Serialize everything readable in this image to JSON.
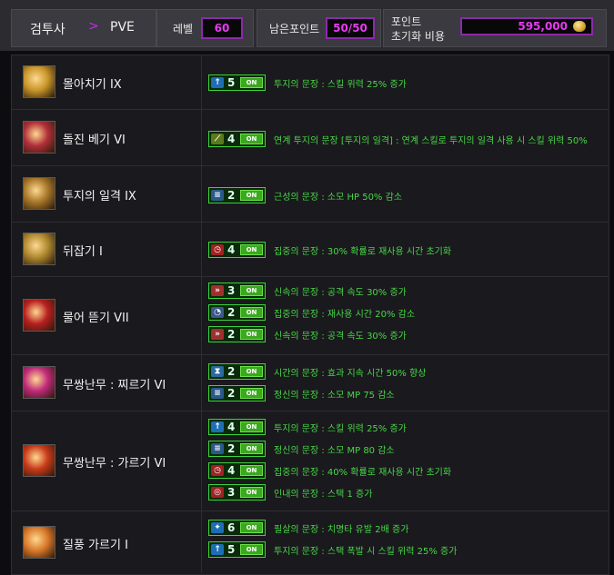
{
  "header": {
    "class_name": "검투사",
    "arrow": ">",
    "mode": "PVE",
    "level_label": "레벨",
    "level_value": "60",
    "points_label": "남은포인트",
    "points_value": "50/50",
    "reset_label_1": "포인트",
    "reset_label_2": "초기화 비용",
    "reset_value": "595,000",
    "coin_icon": "gold-coin-icon"
  },
  "skills": [
    {
      "name": "몰아치기 IX",
      "icon": "storm-slash-icon",
      "icon_color": "#c8962a",
      "sigils": [
        {
          "icon": "attack-up-icon",
          "level": "5",
          "on": "ON",
          "text": "투지의 문장 : 스킬 위력 25% 증가"
        }
      ]
    },
    {
      "name": "돌진 베기 VI",
      "icon": "dash-slash-icon",
      "icon_color": "#b0303a",
      "sigils": [
        {
          "icon": "sword-icon",
          "level": "4",
          "on": "ON",
          "text": "연계 투지의 문장 [투지의 일격] : 연계 스킬로 투지의 일격 사용 시 스킬 위력 50%"
        }
      ]
    },
    {
      "name": "투지의 일격 IX",
      "icon": "fighting-strike-icon",
      "icon_color": "#a8782a",
      "sigils": [
        {
          "icon": "mp-cost-icon",
          "level": "2",
          "on": "ON",
          "text": "근성의 문장 : 소모 HP 50% 감소"
        }
      ]
    },
    {
      "name": "뒤잡기 I",
      "icon": "back-grab-icon",
      "icon_color": "#b08a30",
      "sigils": [
        {
          "icon": "cooldown-icon",
          "level": "4",
          "on": "ON",
          "text": "집중의 문장 : 30% 확률로 재사용 시간 초기화"
        }
      ]
    },
    {
      "name": "물어 뜯기 VII",
      "icon": "bite-icon",
      "icon_color": "#b82020",
      "sigils": [
        {
          "icon": "speed-icon",
          "level": "3",
          "on": "ON",
          "text": "신속의 문장 : 공격 속도 30% 증가"
        },
        {
          "icon": "cooldown-reduce-icon",
          "level": "2",
          "on": "ON",
          "text": "집중의 문장 : 재사용 시간 20% 감소"
        },
        {
          "icon": "speed-icon",
          "level": "2",
          "on": "ON",
          "text": "신속의 문장 : 공격 속도 30% 증가"
        }
      ]
    },
    {
      "name": "무쌍난무 : 찌르기 VI",
      "icon": "blade-dance-pierce-icon",
      "icon_color": "#c02a7a",
      "sigils": [
        {
          "icon": "duration-icon",
          "level": "2",
          "on": "ON",
          "text": "시간의 문장 : 효과 지속 시간 50% 향상"
        },
        {
          "icon": "mp-cost-icon",
          "level": "2",
          "on": "ON",
          "text": "정신의 문장 : 소모 MP 75 감소"
        }
      ]
    },
    {
      "name": "무쌍난무 : 가르기 VI",
      "icon": "blade-dance-cut-icon",
      "icon_color": "#c83a1a",
      "sigils": [
        {
          "icon": "attack-up-icon",
          "level": "4",
          "on": "ON",
          "text": "투지의 문장 : 스킬 위력 25% 증가"
        },
        {
          "icon": "mp-cost-icon",
          "level": "2",
          "on": "ON",
          "text": "정신의 문장 : 소모 MP 80 감소"
        },
        {
          "icon": "cooldown-icon",
          "level": "4",
          "on": "ON",
          "text": "집중의 문장 : 40% 확률로 재사용 시간 초기화"
        },
        {
          "icon": "stack-icon",
          "level": "3",
          "on": "ON",
          "text": "인내의 문장 : 스택 1 증가"
        }
      ]
    },
    {
      "name": "질풍 가르기 I",
      "icon": "gale-cut-icon",
      "icon_color": "#d8782a",
      "sigils": [
        {
          "icon": "crit-icon",
          "level": "6",
          "on": "ON",
          "text": "필살의 문장 : 치명타 유발 2배 증가"
        },
        {
          "icon": "attack-up-icon",
          "level": "5",
          "on": "ON",
          "text": "투지의 문장 : 스택 폭발 시 스킬 위력 25% 증가"
        }
      ]
    }
  ]
}
